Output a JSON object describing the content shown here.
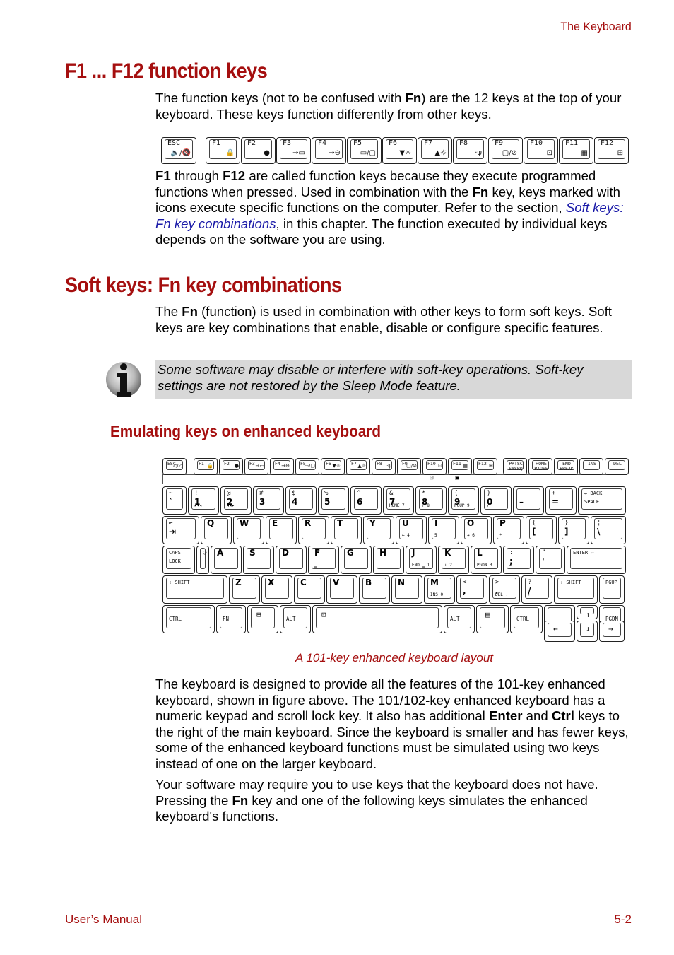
{
  "header": {
    "section_title": "The Keyboard"
  },
  "footer": {
    "left": "User’s Manual",
    "right": "5-2"
  },
  "section1": {
    "heading": "F1 ... F12 function keys",
    "para1": {
      "pre": "The function keys (not to be confused with ",
      "bold": "Fn",
      "post": ") are the 12 keys at the top of your keyboard. These keys function differently from other keys."
    },
    "para2": {
      "b1": "F1",
      "t1": " through ",
      "b2": "F12",
      "t2": " are called function keys because they execute programmed functions when pressed. Used in combination with the ",
      "b3": "Fn",
      "t3": " key, keys marked with icons execute specific functions on the computer. Refer to the section, ",
      "link": "Soft keys: Fn key combinations",
      "t4": ", in this chapter. The function executed by individual keys depends on the software you are using."
    }
  },
  "function_key_row": [
    {
      "label": "ESC",
      "icon": "🔈/🔇",
      "icon_name": "mute-icon"
    },
    {
      "label": "F1",
      "icon": "🔒",
      "icon_name": "lock-icon"
    },
    {
      "label": "F2",
      "icon": "●",
      "icon_name": "power-plan-icon"
    },
    {
      "label": "F3",
      "icon": "→▭",
      "icon_name": "sleep-icon"
    },
    {
      "label": "F4",
      "icon": "→⊖",
      "icon_name": "hibernate-icon"
    },
    {
      "label": "F5",
      "icon": "▭/▢",
      "icon_name": "display-switch-icon"
    },
    {
      "label": "F6",
      "icon": "▼☼",
      "icon_name": "brightness-down-icon"
    },
    {
      "label": "F7",
      "icon": "▲☼",
      "icon_name": "brightness-up-icon"
    },
    {
      "label": "F8",
      "icon": "·ψ",
      "icon_name": "wireless-icon"
    },
    {
      "label": "F9",
      "icon": "▢/⊘",
      "icon_name": "touchpad-icon"
    },
    {
      "label": "F10",
      "icon": "⊡",
      "icon_name": "arrow-mode-icon"
    },
    {
      "label": "F11",
      "icon": "▦",
      "icon_name": "numeric-mode-icon"
    },
    {
      "label": "F12",
      "icon": "⊞",
      "icon_name": "scroll-lock-icon"
    }
  ],
  "section2": {
    "heading": "Soft keys: Fn key combinations",
    "para1": {
      "pre": "The ",
      "bold": "Fn",
      "post": " (function) is used in combination with other keys to form soft keys. Soft keys are key combinations that enable, disable or configure specific features."
    },
    "note": "Some software may disable or interfere with soft-key operations. Soft-key settings are not restored by the Sleep Mode feature.",
    "subheading": "Emulating keys on enhanced keyboard",
    "caption": "A 101-key enhanced keyboard layout",
    "para2": {
      "t1": "The keyboard is designed to provide all the features of the 101-key enhanced keyboard, shown in figure above. The 101/102-key enhanced keyboard has a numeric keypad and scroll lock key. It also has additional ",
      "b1": "Enter",
      "t2": " and ",
      "b2": "Ctrl",
      "t3": " keys to the right of the main keyboard. Since the keyboard is smaller and has fewer keys, some of the enhanced keyboard functions must be simulated using two keys instead of one on the larger keyboard."
    },
    "para3": {
      "t1": "Your software may require you to use keys that the keyboard does not have. Pressing the ",
      "b1": "Fn",
      "t2": " key and one of the following keys simulates the enhanced keyboard's functions."
    }
  },
  "keyboard": {
    "row0": [
      {
        "l": "ESC",
        "i": "◁/◁"
      },
      {
        "l": "F1",
        "i": "🔒"
      },
      {
        "l": "F2",
        "i": "●"
      },
      {
        "l": "F3",
        "i": "→▭"
      },
      {
        "l": "F4",
        "i": "→⊖"
      },
      {
        "l": "F5",
        "i": "▭/▢"
      },
      {
        "l": "F6",
        "i": "▼☼"
      },
      {
        "l": "F7",
        "i": "▲☼"
      },
      {
        "l": "F8",
        "i": "·ψ"
      },
      {
        "l": "F9",
        "i": "▢/⊘"
      },
      {
        "l": "F10",
        "i": "⊡"
      },
      {
        "l": "F11",
        "i": "▦"
      },
      {
        "l": "F12",
        "i": "⊞"
      },
      {
        "l": "PRTSC\nSYSRQ",
        "i": ""
      },
      {
        "l": "HOME\nPAUSE",
        "i": ""
      },
      {
        "l": "END\nBREAK",
        "i": ""
      },
      {
        "l": "INS",
        "i": ""
      },
      {
        "l": "DEL",
        "i": ""
      }
    ],
    "strip_icons": [
      "⊡",
      "▣"
    ],
    "row1": [
      {
        "t": "~",
        "b": "`",
        "n": ""
      },
      {
        "t": "!",
        "b": "1",
        "n": "▸◂◂"
      },
      {
        "t": "@",
        "b": "2",
        "n": "◂◂▸"
      },
      {
        "t": "#",
        "b": "3",
        "n": ""
      },
      {
        "t": "$",
        "b": "4",
        "n": ""
      },
      {
        "t": "%",
        "b": "5",
        "n": ""
      },
      {
        "t": "^",
        "b": "6",
        "n": ""
      },
      {
        "t": "&",
        "b": "7",
        "n": "HOME  7"
      },
      {
        "t": "*",
        "b": "8",
        "n": "↑   8"
      },
      {
        "t": "(",
        "b": "9",
        "n": "PGUP  9"
      },
      {
        "t": ")",
        "b": "0",
        "n": "/"
      },
      {
        "t": "—",
        "b": "–",
        "n": ""
      },
      {
        "t": "+",
        "b": "=",
        "n": ""
      },
      {
        "t": "← BACK",
        "b": "SPACE",
        "n": ""
      }
    ],
    "row2": [
      {
        "t": "⇤",
        "b": "⇥",
        "n": ""
      },
      {
        "t": "Q",
        "b": "",
        "n": ""
      },
      {
        "t": "W",
        "b": "",
        "n": ""
      },
      {
        "t": "E",
        "b": "",
        "n": ""
      },
      {
        "t": "R",
        "b": "",
        "n": ""
      },
      {
        "t": "T",
        "b": "",
        "n": ""
      },
      {
        "t": "Y",
        "b": "",
        "n": ""
      },
      {
        "t": "U",
        "b": "",
        "n": "←   4"
      },
      {
        "t": "I",
        "b": "",
        "n": "5"
      },
      {
        "t": "O",
        "b": "",
        "n": "→   6"
      },
      {
        "t": "P",
        "b": "",
        "n": "*"
      },
      {
        "t": "{",
        "b": "[",
        "n": ""
      },
      {
        "t": "}",
        "b": "]",
        "n": ""
      },
      {
        "t": "¦",
        "b": "\\",
        "n": ""
      }
    ],
    "row3": [
      {
        "t": "CAPS",
        "b": "LOCK",
        "n": ""
      },
      {
        "t": "○",
        "b": "",
        "n": ""
      },
      {
        "t": "A",
        "b": "",
        "n": ""
      },
      {
        "t": "S",
        "b": "",
        "n": ""
      },
      {
        "t": "D",
        "b": "",
        "n": ""
      },
      {
        "t": "F",
        "b": "",
        "n": "▁"
      },
      {
        "t": "G",
        "b": "",
        "n": ""
      },
      {
        "t": "H",
        "b": "",
        "n": ""
      },
      {
        "t": "J",
        "b": "",
        "n": "END ▁ 1"
      },
      {
        "t": "K",
        "b": "",
        "n": "↓   2"
      },
      {
        "t": "L",
        "b": "",
        "n": "PGDN 3"
      },
      {
        "t": ":",
        "b": ";",
        "n": "–"
      },
      {
        "t": "\"",
        "b": "'",
        "n": ""
      },
      {
        "t": "ENTER ⟵",
        "b": "",
        "n": ""
      }
    ],
    "row4": [
      {
        "t": "⇧ SHIFT",
        "b": "",
        "n": ""
      },
      {
        "t": "Z",
        "b": "",
        "n": ""
      },
      {
        "t": "X",
        "b": "",
        "n": ""
      },
      {
        "t": "C",
        "b": "",
        "n": ""
      },
      {
        "t": "V",
        "b": "",
        "n": ""
      },
      {
        "t": "B",
        "b": "",
        "n": ""
      },
      {
        "t": "N",
        "b": "",
        "n": ""
      },
      {
        "t": "M",
        "b": "",
        "n": "INS  0"
      },
      {
        "t": "<",
        "b": ",",
        "n": ""
      },
      {
        "t": ">",
        "b": ".",
        "n": "DEL  ."
      },
      {
        "t": "?",
        "b": "/",
        "n": "+"
      },
      {
        "t": "⇧ SHIFT",
        "b": "",
        "n": ""
      },
      {
        "t": "PGUP",
        "b": "",
        "n": ""
      }
    ],
    "row5": [
      {
        "t": "CTRL"
      },
      {
        "t": "FN"
      },
      {
        "t": "⊞"
      },
      {
        "t": "ALT"
      },
      {
        "t": "⊡"
      },
      {
        "t": "ALT"
      },
      {
        "t": "▤"
      },
      {
        "t": "CTRL"
      },
      {
        "t": "↑"
      },
      {
        "t": "PGDN"
      }
    ],
    "row6": [
      {
        "t": "←"
      },
      {
        "t": "↓"
      },
      {
        "t": "→"
      }
    ]
  }
}
